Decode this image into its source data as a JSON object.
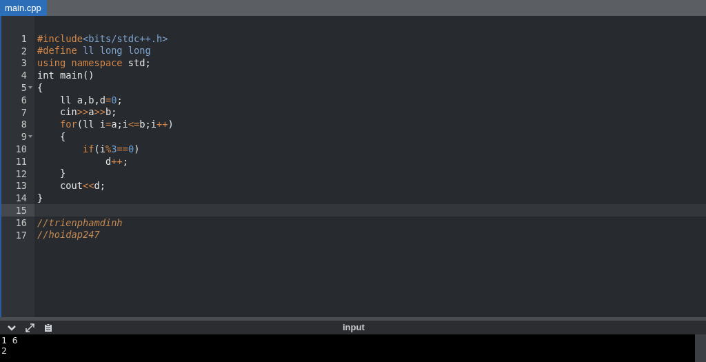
{
  "tabs": [
    {
      "label": "main.cpp",
      "selected": true
    }
  ],
  "editor": {
    "lines": [
      {
        "number": "1",
        "fold": false,
        "current": false,
        "tokens": [
          {
            "kind": "keyword",
            "text": "#include"
          },
          {
            "kind": "string",
            "text": "<bits/stdc++.h>"
          }
        ]
      },
      {
        "number": "2",
        "fold": false,
        "current": false,
        "tokens": [
          {
            "kind": "keyword",
            "text": "#define"
          },
          {
            "kind": "string",
            "text": " ll long long"
          }
        ]
      },
      {
        "number": "3",
        "fold": false,
        "current": false,
        "tokens": [
          {
            "kind": "keyword",
            "text": "using namespace"
          },
          {
            "kind": "plain",
            "text": " std;"
          }
        ]
      },
      {
        "number": "4",
        "fold": false,
        "current": false,
        "tokens": [
          {
            "kind": "plain",
            "text": "int main()"
          }
        ]
      },
      {
        "number": "5",
        "fold": true,
        "current": false,
        "tokens": [
          {
            "kind": "plain",
            "text": "{"
          }
        ]
      },
      {
        "number": "6",
        "fold": false,
        "current": false,
        "tokens": [
          {
            "kind": "plain",
            "text": "    ll a,b,d"
          },
          {
            "kind": "operator",
            "text": "="
          },
          {
            "kind": "number",
            "text": "0"
          },
          {
            "kind": "plain",
            "text": ";"
          }
        ]
      },
      {
        "number": "7",
        "fold": false,
        "current": false,
        "tokens": [
          {
            "kind": "plain",
            "text": "    cin"
          },
          {
            "kind": "operator",
            "text": ">>"
          },
          {
            "kind": "plain",
            "text": "a"
          },
          {
            "kind": "operator",
            "text": ">>"
          },
          {
            "kind": "plain",
            "text": "b;"
          }
        ]
      },
      {
        "number": "8",
        "fold": false,
        "current": false,
        "tokens": [
          {
            "kind": "keyword",
            "text": "    for"
          },
          {
            "kind": "plain",
            "text": "(ll i"
          },
          {
            "kind": "operator",
            "text": "="
          },
          {
            "kind": "plain",
            "text": "a;i"
          },
          {
            "kind": "operator",
            "text": "<="
          },
          {
            "kind": "plain",
            "text": "b;i"
          },
          {
            "kind": "operator",
            "text": "++"
          },
          {
            "kind": "plain",
            "text": ")"
          }
        ]
      },
      {
        "number": "9",
        "fold": true,
        "current": false,
        "tokens": [
          {
            "kind": "plain",
            "text": "    {"
          }
        ]
      },
      {
        "number": "10",
        "fold": false,
        "current": false,
        "tokens": [
          {
            "kind": "keyword",
            "text": "        if"
          },
          {
            "kind": "plain",
            "text": "(i"
          },
          {
            "kind": "operator",
            "text": "%"
          },
          {
            "kind": "number",
            "text": "3"
          },
          {
            "kind": "operator",
            "text": "=="
          },
          {
            "kind": "number",
            "text": "0"
          },
          {
            "kind": "plain",
            "text": ")"
          }
        ]
      },
      {
        "number": "11",
        "fold": false,
        "current": false,
        "tokens": [
          {
            "kind": "plain",
            "text": "            d"
          },
          {
            "kind": "operator",
            "text": "++"
          },
          {
            "kind": "plain",
            "text": ";"
          }
        ]
      },
      {
        "number": "12",
        "fold": false,
        "current": false,
        "tokens": [
          {
            "kind": "plain",
            "text": "    }"
          }
        ]
      },
      {
        "number": "13",
        "fold": false,
        "current": false,
        "tokens": [
          {
            "kind": "plain",
            "text": "    cout"
          },
          {
            "kind": "operator",
            "text": "<<"
          },
          {
            "kind": "plain",
            "text": "d;"
          }
        ]
      },
      {
        "number": "14",
        "fold": false,
        "current": false,
        "tokens": [
          {
            "kind": "plain",
            "text": "}"
          }
        ]
      },
      {
        "number": "15",
        "fold": false,
        "current": true
      },
      {
        "number": "16",
        "fold": false,
        "current": false,
        "tokens": [
          {
            "kind": "comment",
            "text": "//trienphamdinh"
          }
        ]
      },
      {
        "number": "17",
        "fold": false,
        "current": false,
        "tokens": [
          {
            "kind": "comment",
            "text": "//hoidap247"
          }
        ]
      }
    ]
  },
  "panel": {
    "title": "input",
    "output_lines": [
      "1 6",
      "2"
    ]
  }
}
